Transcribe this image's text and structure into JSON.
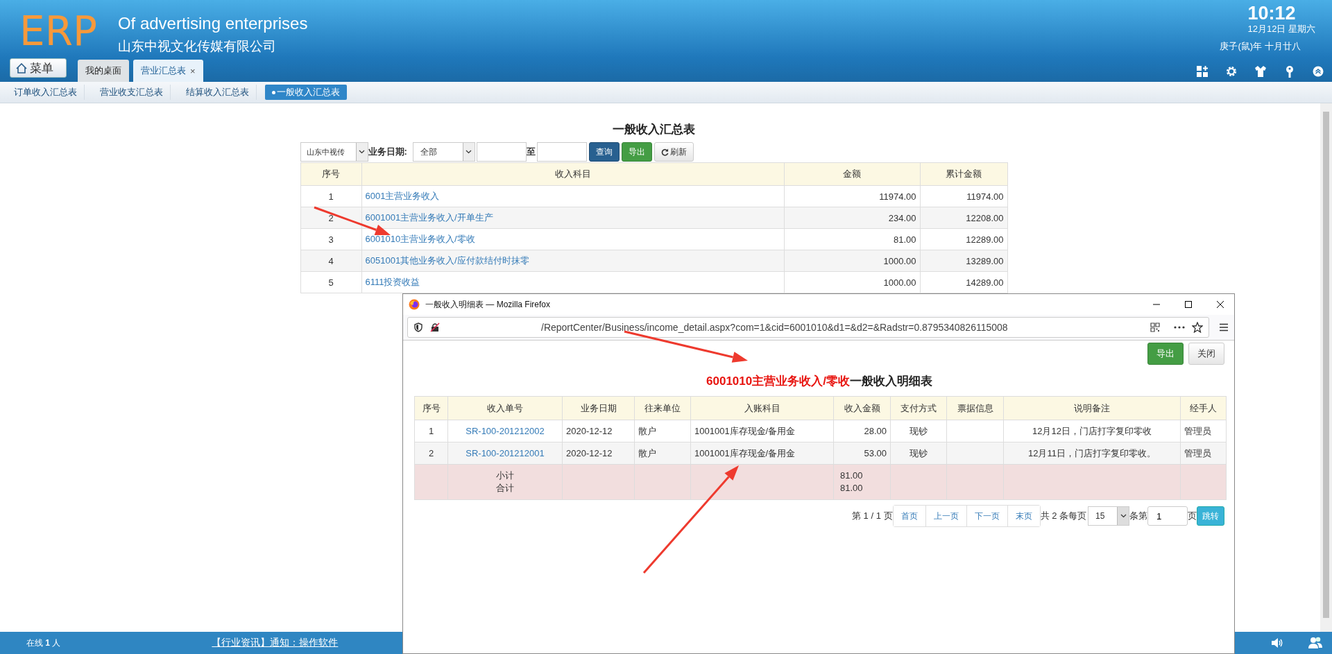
{
  "header": {
    "logo": "ERP",
    "title": "Of advertising enterprises",
    "company": "山东中视文化传媒有限公司",
    "time": "10:12",
    "date": "12月12日 星期六",
    "lunar": "庚子(鼠)年 十月廿八",
    "menu_button": "菜单"
  },
  "tabs": [
    {
      "label": "我的桌面",
      "selected": false
    },
    {
      "label": "营业汇总表",
      "selected": true,
      "close": "×"
    }
  ],
  "subnav": [
    {
      "label": "订单收入汇总表",
      "selected": false
    },
    {
      "label": "营业收支汇总表",
      "selected": false
    },
    {
      "label": "结算收入汇总表",
      "selected": false
    },
    {
      "label": "一般收入汇总表",
      "selected": true
    }
  ],
  "report": {
    "title": "一般收入汇总表",
    "filters": {
      "company": "山东中视传",
      "date_label": "业务日期:",
      "range": "全部",
      "to": "至",
      "buttons": [
        {
          "label": "查询",
          "kind": "primary"
        },
        {
          "label": "导出",
          "kind": "success"
        },
        {
          "label": "刷新",
          "kind": "refresh"
        }
      ]
    },
    "columns": [
      "序号",
      "收入科目",
      "金额",
      "累计金额"
    ],
    "rows": [
      {
        "no": "1",
        "subject": "6001主营业务收入",
        "amount": "11974.00",
        "cumulative": "11974.00"
      },
      {
        "no": "2",
        "subject": "6001001主营业务收入/开单生产",
        "amount": "234.00",
        "cumulative": "12208.00"
      },
      {
        "no": "3",
        "subject": "6001010主营业务收入/零收",
        "amount": "81.00",
        "cumulative": "12289.00"
      },
      {
        "no": "4",
        "subject": "6051001其他业务收入/应付款结付时抹零",
        "amount": "1000.00",
        "cumulative": "13289.00"
      },
      {
        "no": "5",
        "subject": "6111投资收益",
        "amount": "1000.00",
        "cumulative": "14289.00"
      }
    ]
  },
  "popup": {
    "window_title": "一般收入明细表 — Mozilla Firefox",
    "url": "/ReportCenter/Business/income_detail.aspx?com=1&cid=6001010&d1=&d2=&Radstr=0.8795340826115008",
    "buttons": [
      {
        "label": "导出",
        "kind": "success"
      },
      {
        "label": "关闭",
        "kind": "default"
      }
    ],
    "title_highlight": "6001010主营业务收入/零收",
    "title_rest": "一般收入明细表",
    "columns": [
      "序号",
      "收入单号",
      "业务日期",
      "往来单位",
      "入账科目",
      "收入金额",
      "支付方式",
      "票据信息",
      "说明备注",
      "经手人"
    ],
    "rows": [
      {
        "no": "1",
        "receipt_no": "SR-100-201212002",
        "date": "2020-12-12",
        "partner": "散户",
        "account": "1001001库存现金/备用金",
        "amount": "28.00",
        "payment": "现钞",
        "note": "12月12日，门店打字复印零收",
        "handler": "管理员"
      },
      {
        "no": "2",
        "receipt_no": "SR-100-201212001",
        "date": "2020-12-12",
        "partner": "散户",
        "account": "1001001库存现金/备用金",
        "amount": "53.00",
        "payment": "现钞",
        "note": "12月11日，门店打字复印零收。",
        "handler": "管理员"
      }
    ],
    "summary": [
      {
        "label": "小计",
        "amount": "81.00"
      },
      {
        "label": "合计",
        "amount": "81.00"
      }
    ],
    "pager": {
      "page_info": "第 1 / 1 页",
      "nav": [
        "首页",
        "上一页",
        "下一页",
        "末页"
      ],
      "total": "共 2 条每页",
      "page_size": "15",
      "item_label": "条第",
      "page_input": "1",
      "page_label": "页",
      "go": "跳转"
    }
  },
  "status_bar": {
    "online_label": "在线",
    "online_count": "1",
    "online_unit": "人",
    "notice": "【行业资讯】通知：操作软件"
  }
}
